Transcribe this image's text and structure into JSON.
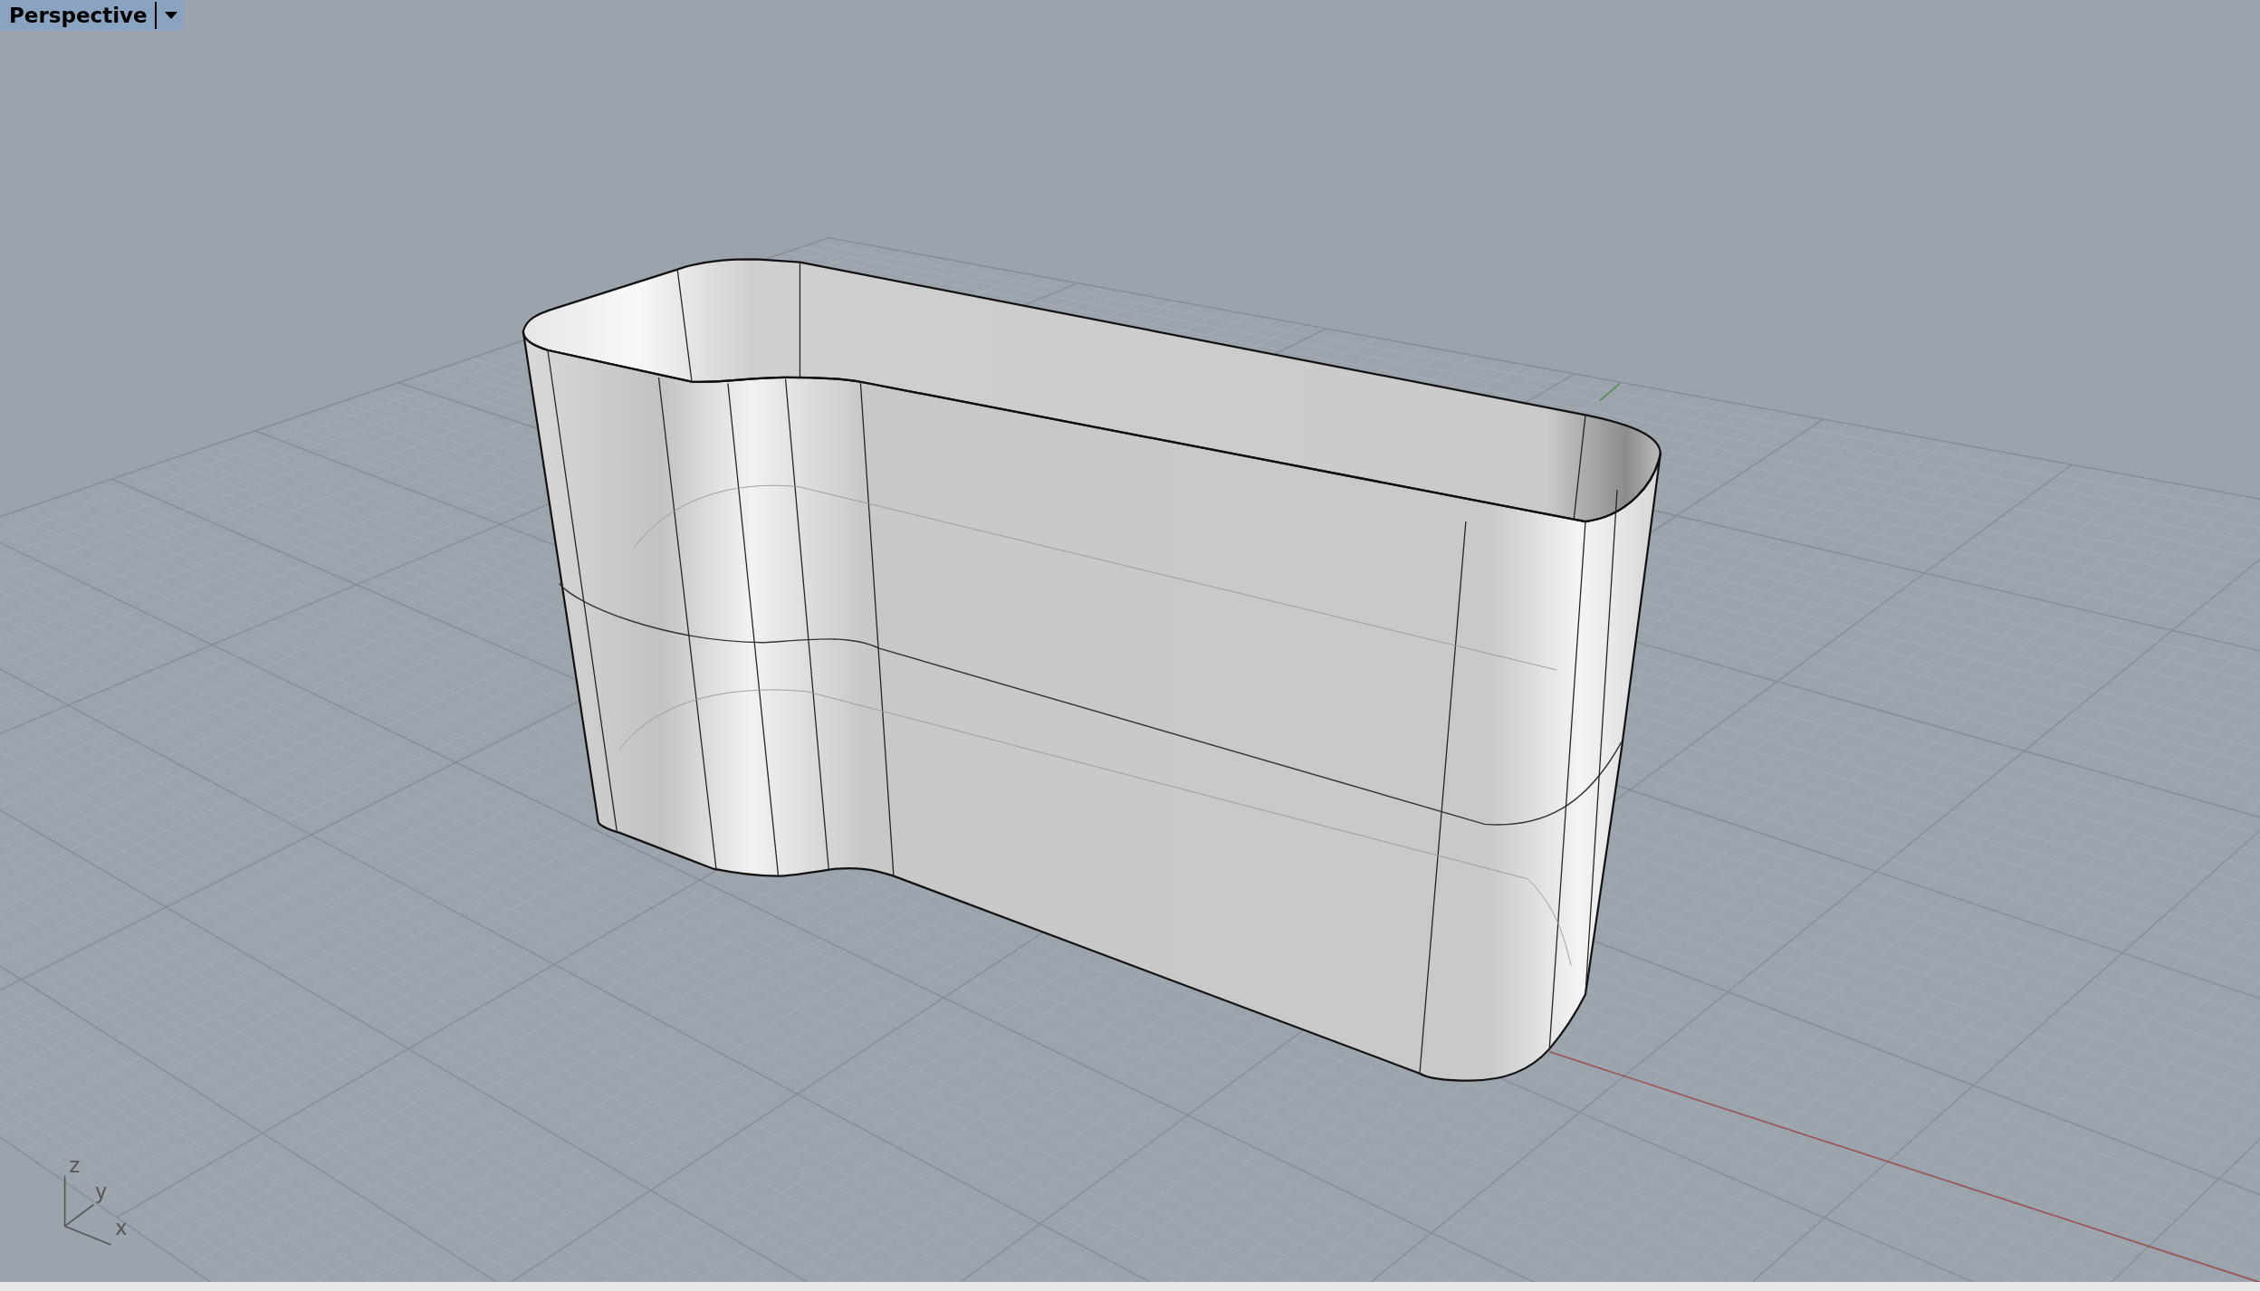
{
  "viewport": {
    "title": "Perspective",
    "axis_labels": [
      "z",
      "y",
      "x"
    ]
  }
}
